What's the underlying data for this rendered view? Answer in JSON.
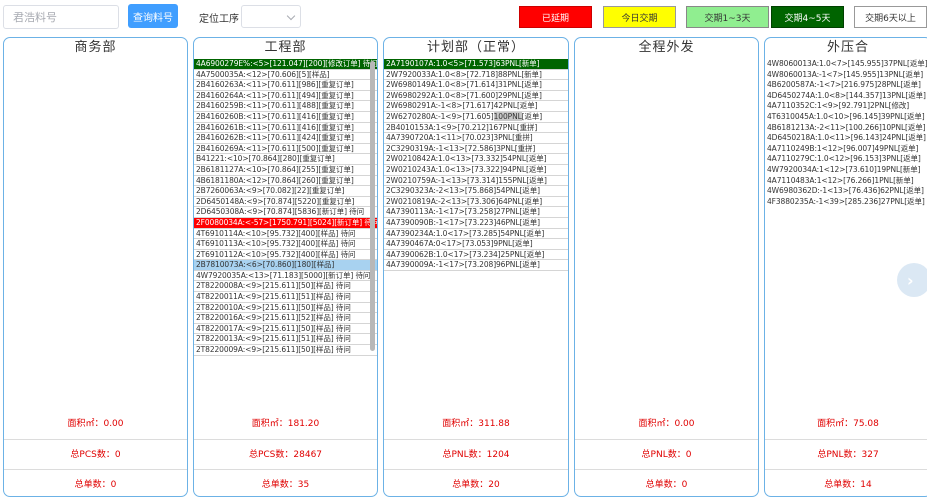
{
  "toolbar": {
    "search_placeholder": "君浩料号",
    "query_label": "查询料号",
    "locate_label": "定位工序",
    "locate_value": ""
  },
  "legend": {
    "overdue": "已延期",
    "today": "今日交期",
    "days_1_3": "交期1~3天",
    "days_4_5": "交期4~5天",
    "days_6_plus": "交期6天以上"
  },
  "colors": {
    "accent": "#409eff",
    "panel_border": "#6cb2e6",
    "overdue": "#ff0000",
    "today": "#ffff00",
    "days_1_3": "#90ee90",
    "days_4_5": "#006400",
    "stat_text": "#e00000",
    "selected_row": "#a8d2f0"
  },
  "icons": {
    "select_arrow": "chevron-down-icon",
    "carousel_next": "chevron-right-icon"
  },
  "panels": [
    {
      "title": "商务部",
      "orders": [],
      "area": "面积㎡：0.00",
      "count": "总PCS数：0",
      "total": "总单数：0"
    },
    {
      "title": "工程部",
      "orders": [
        {
          "text": "4A6900279E%:<5>[121.047][200][修改订单] 待问",
          "status": "green"
        },
        {
          "text": "4A7500035A:<12>[70.606][5][样品]",
          "status": ""
        },
        {
          "text": "2B4160263A:<11>[70.611][986][重复订单]",
          "status": ""
        },
        {
          "text": "2B4160264A:<11>[70.611][494][重复订单]",
          "status": ""
        },
        {
          "text": "2B4160259B:<11>[70.611][488][重复订单]",
          "status": ""
        },
        {
          "text": "2B4160260B:<11>[70.611][416][重复订单]",
          "status": ""
        },
        {
          "text": "2B4160261B:<11>[70.611][416][重复订单]",
          "status": ""
        },
        {
          "text": "2B4160262B:<11>[70.611][424][重复订单]",
          "status": ""
        },
        {
          "text": "2B4160269A:<11>[70.611][500][重复订单]",
          "status": ""
        },
        {
          "text": "B41221:<10>[70.864][280][重复订单]",
          "status": ""
        },
        {
          "text": "2B6181127A:<10>[70.864][255][重复订单]",
          "status": ""
        },
        {
          "text": "4B6181180A:<12>[70.864][260][重复订单]",
          "status": ""
        },
        {
          "text": "2B7260063A:<9>[70.082][22][重复订单]",
          "status": ""
        },
        {
          "text": "2D6450148A:<9>[70.874][5220][重复订单]",
          "status": ""
        },
        {
          "text": "2D6450308A:<9>[70.874][5836][新订单] 待问",
          "status": ""
        },
        {
          "text": "2F0080034A:<-57>[1750.791][5024][新订单] 待问",
          "status": "red"
        },
        {
          "text": "4T6910114A:<10>[95.732][400][样品] 待问",
          "status": ""
        },
        {
          "text": "4T6910113A:<10>[95.732][400][样品] 待问",
          "status": ""
        },
        {
          "text": "2T6910112A:<10>[95.732][400][样品] 待问",
          "status": ""
        },
        {
          "text": "2B7810073A:<6>[70.860][180][样品]",
          "status": "blue"
        },
        {
          "text": "4W7920035A:<13>[71.183][5000][新订单] 待问",
          "status": ""
        },
        {
          "text": "2T8220008A:<9>[215.611][50][样品] 待问",
          "status": ""
        },
        {
          "text": "4T8220011A:<9>[215.611][51][样品] 待问",
          "status": ""
        },
        {
          "text": "2T8220010A:<9>[215.611][50][样品] 待问",
          "status": ""
        },
        {
          "text": "2T8220016A:<9>[215.611][52][样品] 待问",
          "status": ""
        },
        {
          "text": "4T8220017A:<9>[215.611][50][样品] 待问",
          "status": ""
        },
        {
          "text": "2T8220013A:<9>[215.611][51][样品] 待问",
          "status": ""
        },
        {
          "text": "2T8220009A:<9>[215.611][50][样品] 待问",
          "status": ""
        }
      ],
      "area": "面积㎡：181.20",
      "count": "总PCS数：28467",
      "total": "总单数：35"
    },
    {
      "title": "计划部（正常）",
      "orders": [
        {
          "text": "2A7190107A:1.0<5>[71.573]63PNL[新单]",
          "status": "green"
        },
        {
          "text": "2W7920033A:1.0<8>[72.718]88PNL[新单]",
          "status": ""
        },
        {
          "text": "2W6980149A:1.0<8>[71.614]31PNL[返单]",
          "status": ""
        },
        {
          "text": "2W6980292A:1.0<8>[71.600]29PNL[返单]",
          "status": ""
        },
        {
          "text": "2W6980291A:-1<8>[71.617]42PNL[返单]",
          "status": ""
        },
        {
          "text": "2W6270280A:-1<9>[71.605]",
          "hl": "100PNL",
          "rest": "[返单]",
          "status": ""
        },
        {
          "text": "2B4010153A:1<9>[70.212]167PNL[重拼]",
          "status": ""
        },
        {
          "text": "4A7390720A:1<11>[70.023]3PNL[重拼]",
          "status": ""
        },
        {
          "text": "2C3290319A:-1<13>[72.586]3PNL[重拼]",
          "status": ""
        },
        {
          "text": "2W0210842A:1.0<13>[73.332]54PNL[返单]",
          "status": ""
        },
        {
          "text": "2W0210243A:1.0<13>[73.322]94PNL[返单]",
          "status": ""
        },
        {
          "text": "2W0210759A:-1<13>[73.314]155PNL[返单]",
          "status": ""
        },
        {
          "text": "2C3290323A:-2<13>[75.868]54PNL[返单]",
          "status": ""
        },
        {
          "text": "2W0210819A:-2<13>[73.306]64PNL[返单]",
          "status": ""
        },
        {
          "text": "4A7390113A:-1<17>[73.258]27PNL[返单]",
          "status": ""
        },
        {
          "text": "4A7390090B:-1<17>[73.223]46PNL[返单]",
          "status": ""
        },
        {
          "text": "4A7390234A:1.0<17>[73.285]54PNL[返单]",
          "status": ""
        },
        {
          "text": "4A7390467A:0<17>[73.053]9PNL[返单]",
          "status": ""
        },
        {
          "text": "4A7390062B:1.0<17>[73.234]25PNL[返单]",
          "status": ""
        },
        {
          "text": "4A7390009A:-1<17>[73.208]96PNL[返单]",
          "status": ""
        }
      ],
      "area": "面积㎡：311.88",
      "count": "总PNL数：1204",
      "total": "总单数：20"
    },
    {
      "title": "全程外发",
      "orders": [],
      "area": "面积㎡：0.00",
      "count": "总PNL数：0",
      "total": "总单数：0"
    },
    {
      "title": "外压合",
      "orders": [
        {
          "text": "4W8060013A:1.0<7>[145.955]37PNL[返单]",
          "status": ""
        },
        {
          "text": "4W8060013A:-1<7>[145.955]13PNL[返单]",
          "status": ""
        },
        {
          "text": "4B6200587A:-1<7>[216.975]28PNL[返单]",
          "status": ""
        },
        {
          "text": "4D6450274A:1.0<8>[144.357]13PNL[返单]",
          "status": ""
        },
        {
          "text": "4A7110352C:1<9>[92.791]2PNL[修改]",
          "status": ""
        },
        {
          "text": "4T6310045A:1.0<10>[96.145]39PNL[返单]",
          "status": ""
        },
        {
          "text": "4B6181213A:-2<11>[100.266]10PNL[返单]",
          "status": ""
        },
        {
          "text": "4D6450218A:1.0<11>[96.143]24PNL[返单]",
          "status": ""
        },
        {
          "text": "4A7110249B:1<12>[96.007]49PNL[返单]",
          "status": ""
        },
        {
          "text": "4A7110279C:1.0<12>[96.153]3PNL[返单]",
          "status": ""
        },
        {
          "text": "4W7920034A:1<12>[73.610]19PNL[新单]",
          "status": ""
        },
        {
          "text": "4A7110483A:1<12>[76.266]1PNL[新单]",
          "status": ""
        },
        {
          "text": "4W6980362D:-1<13>[76.436]62PNL[返单]",
          "status": ""
        },
        {
          "text": "4F3880235A:-1<39>[285.236]27PNL[返单]",
          "status": ""
        }
      ],
      "area": "面积㎡：75.08",
      "count": "总PNL数：327",
      "total": "总单数：14"
    }
  ]
}
